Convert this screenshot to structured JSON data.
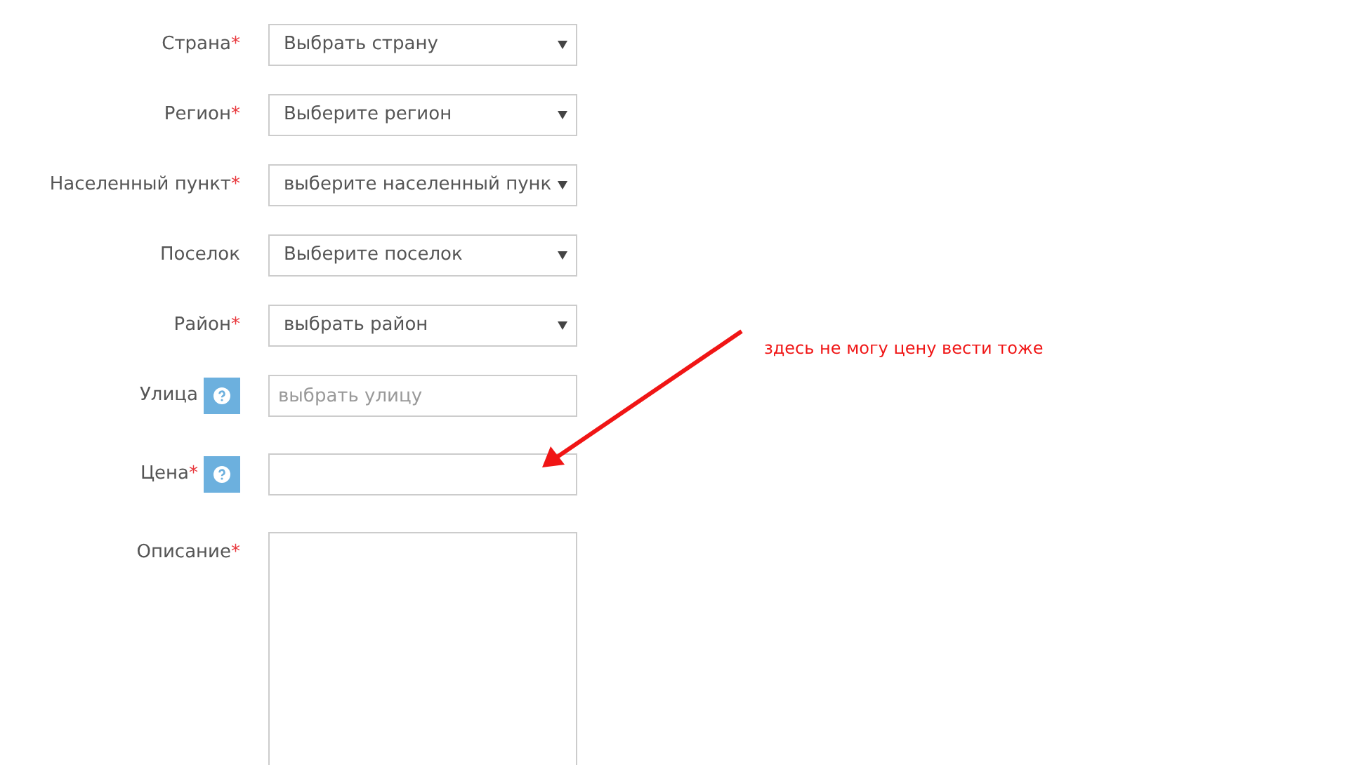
{
  "fields": [
    {
      "label": "Страна",
      "required_mark": "*",
      "help": false,
      "kind": "select",
      "value": "Выбрать страну"
    },
    {
      "label": "Регион",
      "required_mark": "*",
      "help": false,
      "kind": "select",
      "value": "Выберите регион"
    },
    {
      "label": "Населенный пункт",
      "required_mark": "*",
      "help": false,
      "kind": "select",
      "value": "выберите населенный пунк"
    },
    {
      "label": "Поселок",
      "help": false,
      "kind": "select",
      "value": "Выберите поселок"
    },
    {
      "label": "Район",
      "required_mark": "*",
      "help": false,
      "kind": "select",
      "value": "выбрать район"
    },
    {
      "label": "Улица",
      "help": true,
      "kind": "input",
      "placeholder": "выбрать улицу"
    },
    {
      "label": "Цена",
      "required_mark": "*",
      "help": true,
      "kind": "input"
    },
    {
      "label": "Описание",
      "required_mark": "*",
      "help": false,
      "kind": "textarea"
    }
  ],
  "annotation": {
    "text": "здесь не могу цену вести тоже"
  }
}
